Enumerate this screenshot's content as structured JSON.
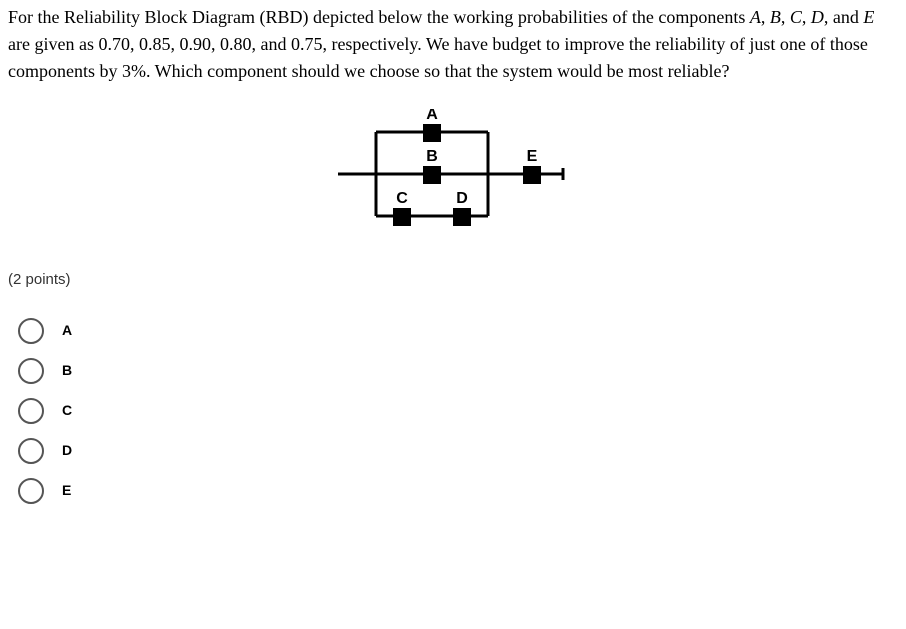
{
  "question": {
    "text_pre": "For the Reliability Block Diagram (RBD) depicted below the working probabilities of the components ",
    "comp_A": "A",
    "sep1": ", ",
    "comp_B": "B",
    "sep2": ", ",
    "comp_C": "C",
    "sep3": ", ",
    "comp_D": "D",
    "sep4": ", and ",
    "comp_E": "E",
    "text_post": " are given as 0.70, 0.85, 0.90, 0.80, and 0.75, respectively. We have budget to improve the reliability of just one of those components by 3%. Which component should we choose so that the system would be most reliable?"
  },
  "diagram": {
    "labels": {
      "A": "A",
      "B": "B",
      "C": "C",
      "D": "D",
      "E": "E"
    }
  },
  "points": "(2 points)",
  "options": [
    {
      "label": "A"
    },
    {
      "label": "B"
    },
    {
      "label": "C"
    },
    {
      "label": "D"
    },
    {
      "label": "E"
    }
  ]
}
